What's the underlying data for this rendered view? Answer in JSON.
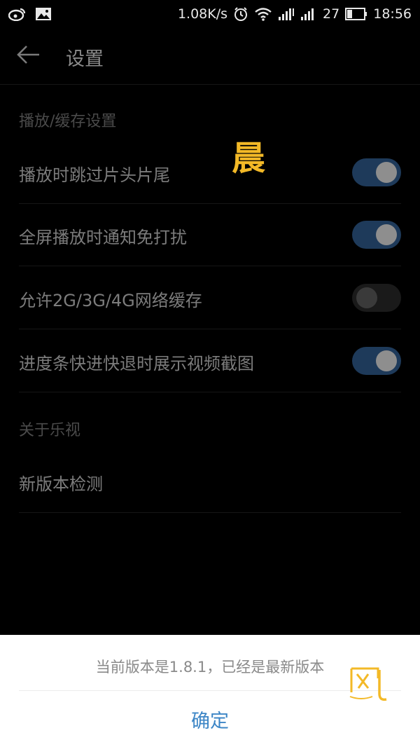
{
  "status_bar": {
    "net_speed": "1.08K/s",
    "battery": "27",
    "time": "18:56"
  },
  "header": {
    "title": "设置"
  },
  "sections": [
    {
      "title": "播放/缓存设置",
      "items": [
        {
          "label": "播放时跳过片头片尾",
          "enabled": true
        },
        {
          "label": "全屏播放时通知免打扰",
          "enabled": true
        },
        {
          "label": "允许2G/3G/4G网络缓存",
          "enabled": false
        },
        {
          "label": "进度条快进快退时展示视频截图",
          "enabled": true
        }
      ]
    },
    {
      "title": "关于乐视",
      "items": [
        {
          "label": "新版本检测"
        }
      ]
    }
  ],
  "overlay_char": "晨",
  "dialog": {
    "message": "当前版本是1.8.1，已经是最新版本",
    "confirm_label": "确定"
  },
  "colors": {
    "accent": "#3d86c6",
    "toggle_on_track": "#1e3a5a",
    "watermark": "#f3b927"
  }
}
